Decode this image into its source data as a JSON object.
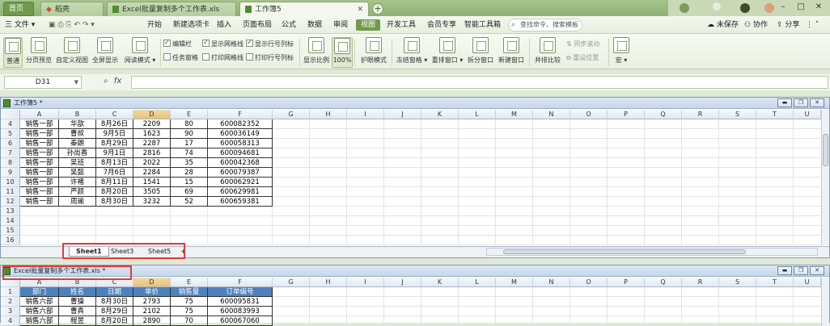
{
  "tabs": [
    {
      "label": "首页"
    },
    {
      "label": "稻壳"
    },
    {
      "label": "Excel批量复制多个工作表.xls"
    },
    {
      "label": "工作簿5"
    }
  ],
  "add_tab": "+",
  "menu": {
    "file": "三 文件 ▾",
    "items": [
      "开始",
      "新建选项卡",
      "插入",
      "页面布局",
      "公式",
      "数据",
      "审阅",
      "视图",
      "开发工具",
      "会员专享",
      "智能工具箱"
    ],
    "active": "视图",
    "search": "查找命令、搜索模板",
    "unsaved": "未保存",
    "collab": "协作",
    "share": "分享"
  },
  "ribbon": {
    "normal": "普通",
    "page_break": "分页预览",
    "custom_view": "自定义视图",
    "fullscreen": "全屏显示",
    "reading": "阅读模式 ▾",
    "edit_bar": "编辑栏",
    "show_grid": "显示网格线",
    "show_headers": "显示行号列标",
    "task_pane": "任务窗格",
    "print_grid": "打印网格线",
    "print_headers": "打印行号列标",
    "zoom": "显示比例",
    "zoom100": "100%",
    "eye_mode": "护眼模式",
    "freeze": "冻结窗格 ▾",
    "arrange": "重排窗口 ▾",
    "split": "拆分窗口",
    "new_window": "新建窗口",
    "side_by_side": "并排比较",
    "sync_scroll": "同步滚动",
    "reset_pos": "重设位置",
    "macro": "宏 ▾"
  },
  "formula_bar": {
    "name": "D31",
    "fx": "fx"
  },
  "wb1": {
    "title": "工作簿5 *",
    "columns": [
      "A",
      "B",
      "C",
      "D",
      "E",
      "F",
      "G",
      "H",
      "I",
      "J",
      "K",
      "L",
      "M",
      "N",
      "O",
      "P",
      "Q",
      "R",
      "S",
      "T",
      "U",
      "V"
    ],
    "rows": [
      {
        "n": "4",
        "cells": [
          "销售一部",
          "华歆",
          "8月26日",
          "2209",
          "80",
          "600082352"
        ]
      },
      {
        "n": "5",
        "cells": [
          "销售一部",
          "曹叔",
          "9月5日",
          "1623",
          "90",
          "600036149"
        ]
      },
      {
        "n": "6",
        "cells": [
          "销售一部",
          "秦朗",
          "8月29日",
          "2287",
          "17",
          "600058313"
        ]
      },
      {
        "n": "7",
        "cells": [
          "销售一部",
          "孙尚香",
          "9月1日",
          "2816",
          "74",
          "600094681"
        ]
      },
      {
        "n": "8",
        "cells": [
          "销售一部",
          "吴班",
          "8月13日",
          "2022",
          "35",
          "600042368"
        ]
      },
      {
        "n": "9",
        "cells": [
          "销售一部",
          "吴懿",
          "7月6日",
          "2284",
          "28",
          "600079387"
        ]
      },
      {
        "n": "10",
        "cells": [
          "销售一部",
          "许褚",
          "8月11日",
          "1541",
          "15",
          "600062921"
        ]
      },
      {
        "n": "11",
        "cells": [
          "销售一部",
          "严颜",
          "8月20日",
          "3505",
          "69",
          "600629981"
        ]
      },
      {
        "n": "12",
        "cells": [
          "销售一部",
          "周瑜",
          "8月30日",
          "3232",
          "52",
          "600659381"
        ]
      },
      {
        "n": "13",
        "cells": []
      },
      {
        "n": "14",
        "cells": []
      },
      {
        "n": "15",
        "cells": []
      },
      {
        "n": "16",
        "cells": []
      }
    ],
    "sheets": [
      "Sheet1",
      "Sheet3",
      "Sheet5"
    ],
    "sheet_add": "+"
  },
  "wb2": {
    "title": "Excel批量复制多个工作表.xls *",
    "columns": [
      "A",
      "B",
      "C",
      "D",
      "E",
      "F",
      "G",
      "H",
      "I",
      "J",
      "K",
      "L",
      "M",
      "N",
      "O",
      "P",
      "Q",
      "R",
      "S",
      "T",
      "U",
      "V"
    ],
    "headers": [
      "部门",
      "姓名",
      "日期",
      "单价",
      "销售量",
      "订单编号"
    ],
    "rows": [
      {
        "n": "1",
        "cells": []
      },
      {
        "n": "2",
        "cells": [
          "销售六部",
          "曹操",
          "8月30日",
          "2793",
          "75",
          "600095831"
        ]
      },
      {
        "n": "3",
        "cells": [
          "销售六部",
          "曹真",
          "8月29日",
          "2102",
          "75",
          "600083993"
        ]
      },
      {
        "n": "4",
        "cells": [
          "销售六部",
          "程昱",
          "8月20日",
          "2890",
          "70",
          "600067060"
        ]
      }
    ]
  }
}
